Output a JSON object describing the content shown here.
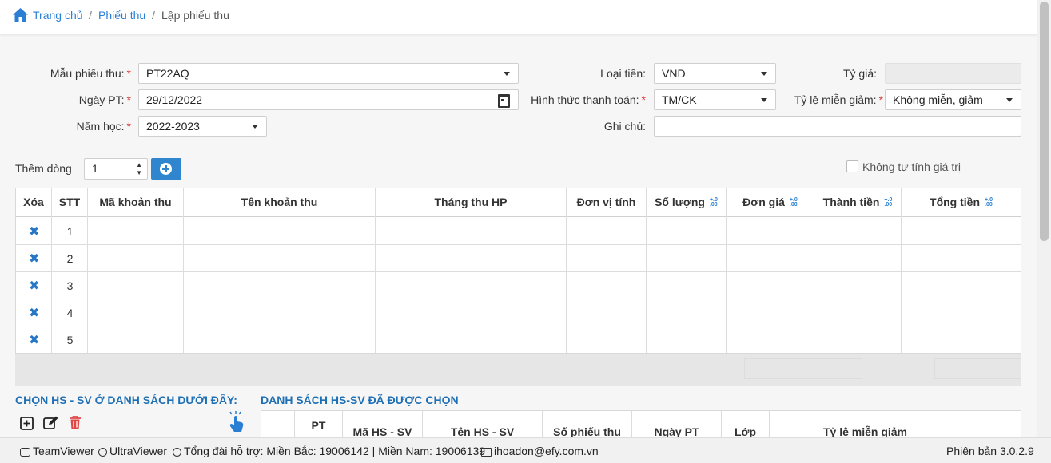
{
  "breadcrumb": {
    "home": "Trang chủ",
    "sep": "/",
    "level1": "Phiếu thu",
    "current": "Lập phiếu thu"
  },
  "form": {
    "mau_phieu_thu": {
      "label": "Mẫu phiếu thu:",
      "value": "PT22AQ"
    },
    "ngay_pt": {
      "label": "Ngày PT:",
      "value": "29/12/2022"
    },
    "nam_hoc": {
      "label": "Năm học:",
      "value": "2022-2023"
    },
    "loai_tien": {
      "label": "Loại tiền:",
      "value": "VND"
    },
    "hinh_thuc": {
      "label": "Hình thức thanh toán:",
      "value": "TM/CK"
    },
    "ghi_chu": {
      "label": "Ghi chú:",
      "value": ""
    },
    "ty_gia": {
      "label": "Tỷ giá:",
      "value": ""
    },
    "ty_le": {
      "label": "Tỷ lệ miễn giảm:",
      "value": "Không miễn, giảm"
    },
    "required_mark": "*"
  },
  "add_row": {
    "label": "Thêm dòng",
    "value": "1",
    "spin_up": "▲",
    "spin_down": "▼"
  },
  "auto_calc": {
    "label": "Không tự tính giá trị"
  },
  "grid": {
    "headers": [
      "Xóa",
      "STT",
      "Mã khoản thu",
      "Tên khoản thu",
      "Tháng thu HP",
      "Đơn vị tính",
      "Số lượng",
      "Đơn giá",
      "Thành tiền",
      "Tổng tiền"
    ],
    "number_format_mark_top": "+.0",
    "number_format_mark_bottom": ".00",
    "delete_glyph": "✖",
    "rows": [
      "1",
      "2",
      "3",
      "4",
      "5"
    ]
  },
  "sections": {
    "left": "CHỌN HS - SV Ở DANH SÁCH DƯỚI ĐÂY:",
    "right": "DANH SÁCH HS-SV ĐÃ ĐƯỢC CHỌN"
  },
  "selected_grid": {
    "headers": [
      "PT",
      "Mã HS - SV",
      "Tên HS - SV",
      "Số phiếu thu",
      "Ngày PT",
      "Lớp",
      "Tỷ lệ miễn giảm"
    ]
  },
  "status_bar": {
    "teamviewer": "TeamViewer",
    "ultraviewer": "UltraViewer",
    "hotline": "Tổng đài hỗ trợ: Miền Bắc: 19006142 | Miền Nam: 19006139",
    "email": "ihoadon@efy.com.vn",
    "version": "Phiên bản 3.0.2.9"
  },
  "colors": {
    "accent": "#2a7fd4",
    "required": "#e23b3b",
    "delete": "#e04848"
  },
  "icons": [
    "home-icon",
    "dropdown-caret-icon",
    "calendar-icon",
    "add-circle-icon",
    "delete-x-icon",
    "add-square-icon",
    "edit-icon",
    "trash-icon",
    "pointer-hand-icon",
    "phone-icon",
    "mail-icon"
  ]
}
